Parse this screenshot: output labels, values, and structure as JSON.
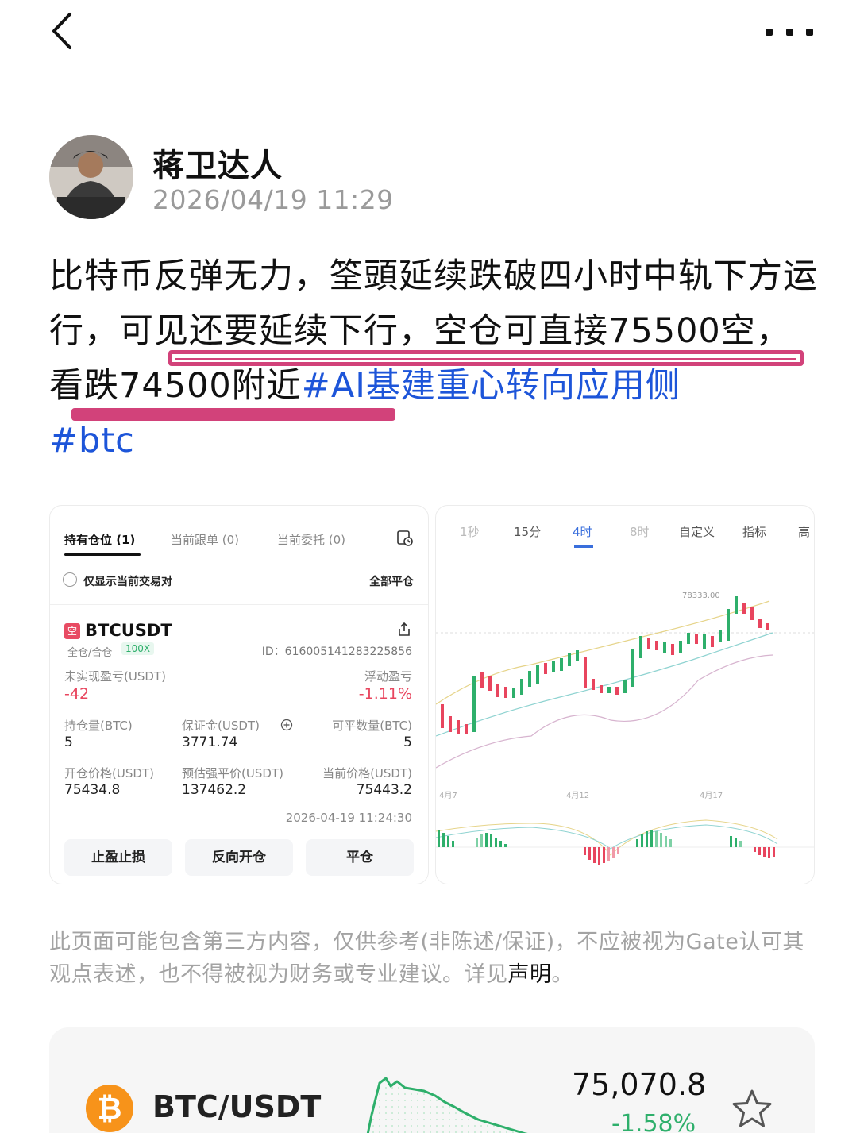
{
  "author": {
    "name": "蒋卫达人",
    "time": "2026/04/19 11:29"
  },
  "post": {
    "text": "比特币反弹无力，筌頭延续跌破四小时中轨下方运行，可见还要延续下行，空仓可直接75500空，看跌74500附近",
    "tags": [
      "#AI基建重心转向应用侧",
      "#btc"
    ]
  },
  "position_card": {
    "tabs": [
      "持有仓位 (1)",
      "当前跟单 (0)",
      "当前委托 (0)"
    ],
    "filter_label": "仅显示当前交易对",
    "close_all": "全部平仓",
    "side_badge": "空",
    "symbol": "BTCUSDT",
    "margin_mode": "全仓/合仓",
    "leverage": "100X",
    "id_text": "ID：616005141283225856",
    "unrealized_label": "未实现盈亏(USDT)",
    "unrealized_value": "-42",
    "floating_label": "浮动盈亏",
    "floating_value": "-1.11%",
    "size_label": "持仓量(BTC)",
    "size_value": "5",
    "margin_label": "保证金(USDT)",
    "margin_value": "3771.74",
    "closable_label": "可平数量(BTC)",
    "closable_value": "5",
    "entry_label": "开仓价格(USDT)",
    "entry_value": "75434.8",
    "liq_label": "预估强平价(USDT)",
    "liq_value": "137462.2",
    "mark_label": "当前价格(USDT)",
    "mark_value": "75443.2",
    "timestamp": "2026-04-19 11:24:30",
    "buttons": [
      "止盈止损",
      "反向开仓",
      "平仓"
    ]
  },
  "kline_card": {
    "intervals": [
      "1秒",
      "15分",
      "4时",
      "8时",
      "自定义",
      "指标",
      "高"
    ],
    "active_interval": "4时",
    "high_label": "78333.00",
    "x_labels": [
      "4月7",
      "4月12",
      "4月17"
    ]
  },
  "disclaimer": {
    "text": "此页面可能包含第三方内容，仅供参考(非陈述/保证)，不应被视为Gate认可其观点表述，也不得被视为财务或专业建议。详见",
    "link": "声明",
    "end": "。"
  },
  "ticker": {
    "pair": "BTC/USDT",
    "price": "75,070.8",
    "change": "-1.58%",
    "colors": {
      "up": "#2eaf6b",
      "down": "#e8455e",
      "btc": "#f7931a"
    }
  }
}
